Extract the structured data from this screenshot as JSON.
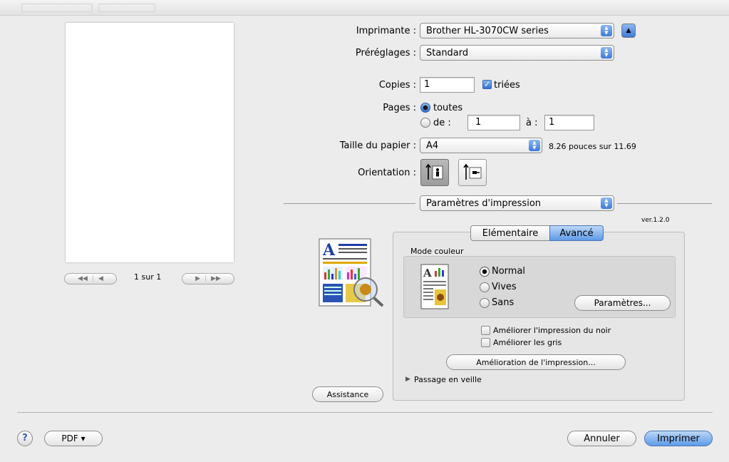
{
  "preview": {
    "page_indicator": "1 sur 1"
  },
  "printer": {
    "label": "Imprimante :",
    "value": "Brother HL-3070CW series"
  },
  "presets": {
    "label": "Préréglages :",
    "value": "Standard"
  },
  "copies": {
    "label": "Copies :",
    "value": "1",
    "collated_label": "triées",
    "collated": true
  },
  "pages": {
    "label": "Pages :",
    "all_label": "toutes",
    "from_label": "de :",
    "from_value": "1",
    "to_label": "à :",
    "to_value": "1"
  },
  "paper": {
    "label": "Taille du papier :",
    "value": "A4",
    "dimensions": "8.26 pouces sur 11.69"
  },
  "orientation": {
    "label": "Orientation :"
  },
  "section_popup": {
    "value": "Paramètres d'impression"
  },
  "version": "ver.1.2.0",
  "tabs": {
    "basic": "Elémentaire",
    "advanced": "Avancé"
  },
  "color_mode": {
    "title": "Mode couleur",
    "options": [
      "Normal",
      "Vives",
      "Sans"
    ],
    "selected": "Normal",
    "settings_button": "Paramètres..."
  },
  "options": {
    "black_label": "Améliorer l'impression du noir",
    "gray_label": "Améliorer les gris",
    "improve_button": "Amélioration de l'impression...",
    "sleep_label": "Passage en veille"
  },
  "buttons": {
    "assistance": "Assistance",
    "help": "?",
    "pdf": "PDF ▾",
    "cancel": "Annuler",
    "print": "Imprimer"
  },
  "colors": {
    "accent_blue": "#3d7ad9",
    "panel_bg": "#e6e6e6",
    "window_bg": "#ececec"
  }
}
